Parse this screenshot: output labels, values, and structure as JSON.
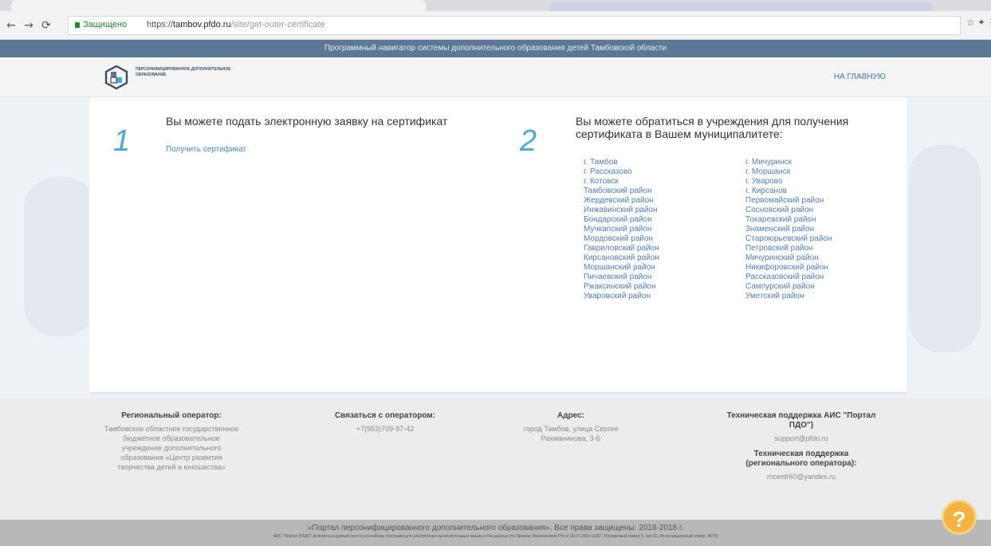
{
  "browser": {
    "secure_label": "Защищено",
    "url_prefix": "https://",
    "url_host": "tambov.pfdo.ru",
    "url_path": "/site/get-outer-certificate"
  },
  "banner": {
    "text": "Программный навигатор системы дополнительного образования детей Тамбовской области"
  },
  "header": {
    "logo_text": "персонифицированное дополнительное образование",
    "home_link": "НА ГЛАВНУЮ"
  },
  "step1": {
    "number": "1",
    "heading": "Вы можете подать электронную заявку на сертификат",
    "link": "Получить сертификат"
  },
  "step2": {
    "number": "2",
    "heading_line1": "Вы можете обратиться в учреждения для получения",
    "heading_line2": "сертификата в Вашем муниципалитете:",
    "col1": [
      "г. Тамбов",
      "г. Рассказово",
      "г. Котовск",
      "Тамбовский район",
      "Жердевский район",
      "Инжавинский район",
      "Бондарский район",
      "Мучкапский район",
      "Мордовский район",
      "Гавриловский район",
      "Кирсановский район",
      "Моршанский район",
      "Пичаевский район",
      "Ржаксинский район",
      "Уваровский район"
    ],
    "col2": [
      "г. Мичуринск",
      "г. Моршанск",
      "г. Уварово",
      "г. Кирсанов",
      "Первомайский район",
      "Сосновский район",
      "Токаревский район",
      "Знаменский район",
      "Староюрьевский район",
      "Петровский район",
      "Мичуринский район",
      "Никифоровский район",
      "Рассказовский район",
      "Сампурский район",
      "Уметский район"
    ]
  },
  "footer": {
    "operator_title": "Региональный оператор:",
    "operator_text": "Тамбовское областное государственное бюджетное образовательное учреждение дополнительного образования «Центр развития творчества детей и юношества»",
    "contact_title": "Связаться с оператором:",
    "contact_phone": "+7(953)709-97-42",
    "address_title": "Адрес:",
    "address_text": "город Тамбов, улица Сергея Рахманинова, 3-Б",
    "support_title": "Техническая поддержка АИС \"Портал ПДО\")",
    "support_email": "support@pfdo.ru",
    "regional_support_title": "Техническая поддержка (регионального оператора):",
    "regional_support_email": "mcentr60@yandex.ru"
  },
  "copyright": {
    "line1": "«Портал персонифицированного дополнительного образования». Все права защищены. 2016-2018 г.",
    "line2": "АИС \"Портал ПФДО\" включена в единый реестр российских программ для электронных вычислительных машин и баз данных (по Приказу Минкомсвязи РФ от 30.07.2018 №367, Порядковый номер 5, №п-10, Регистрационный номер: 4679)"
  },
  "help_button": {
    "label": "?"
  },
  "colors": {
    "accent": "#4da9d6",
    "link": "#5280b3",
    "banner": "#5b7896",
    "help": "#f4b340"
  }
}
